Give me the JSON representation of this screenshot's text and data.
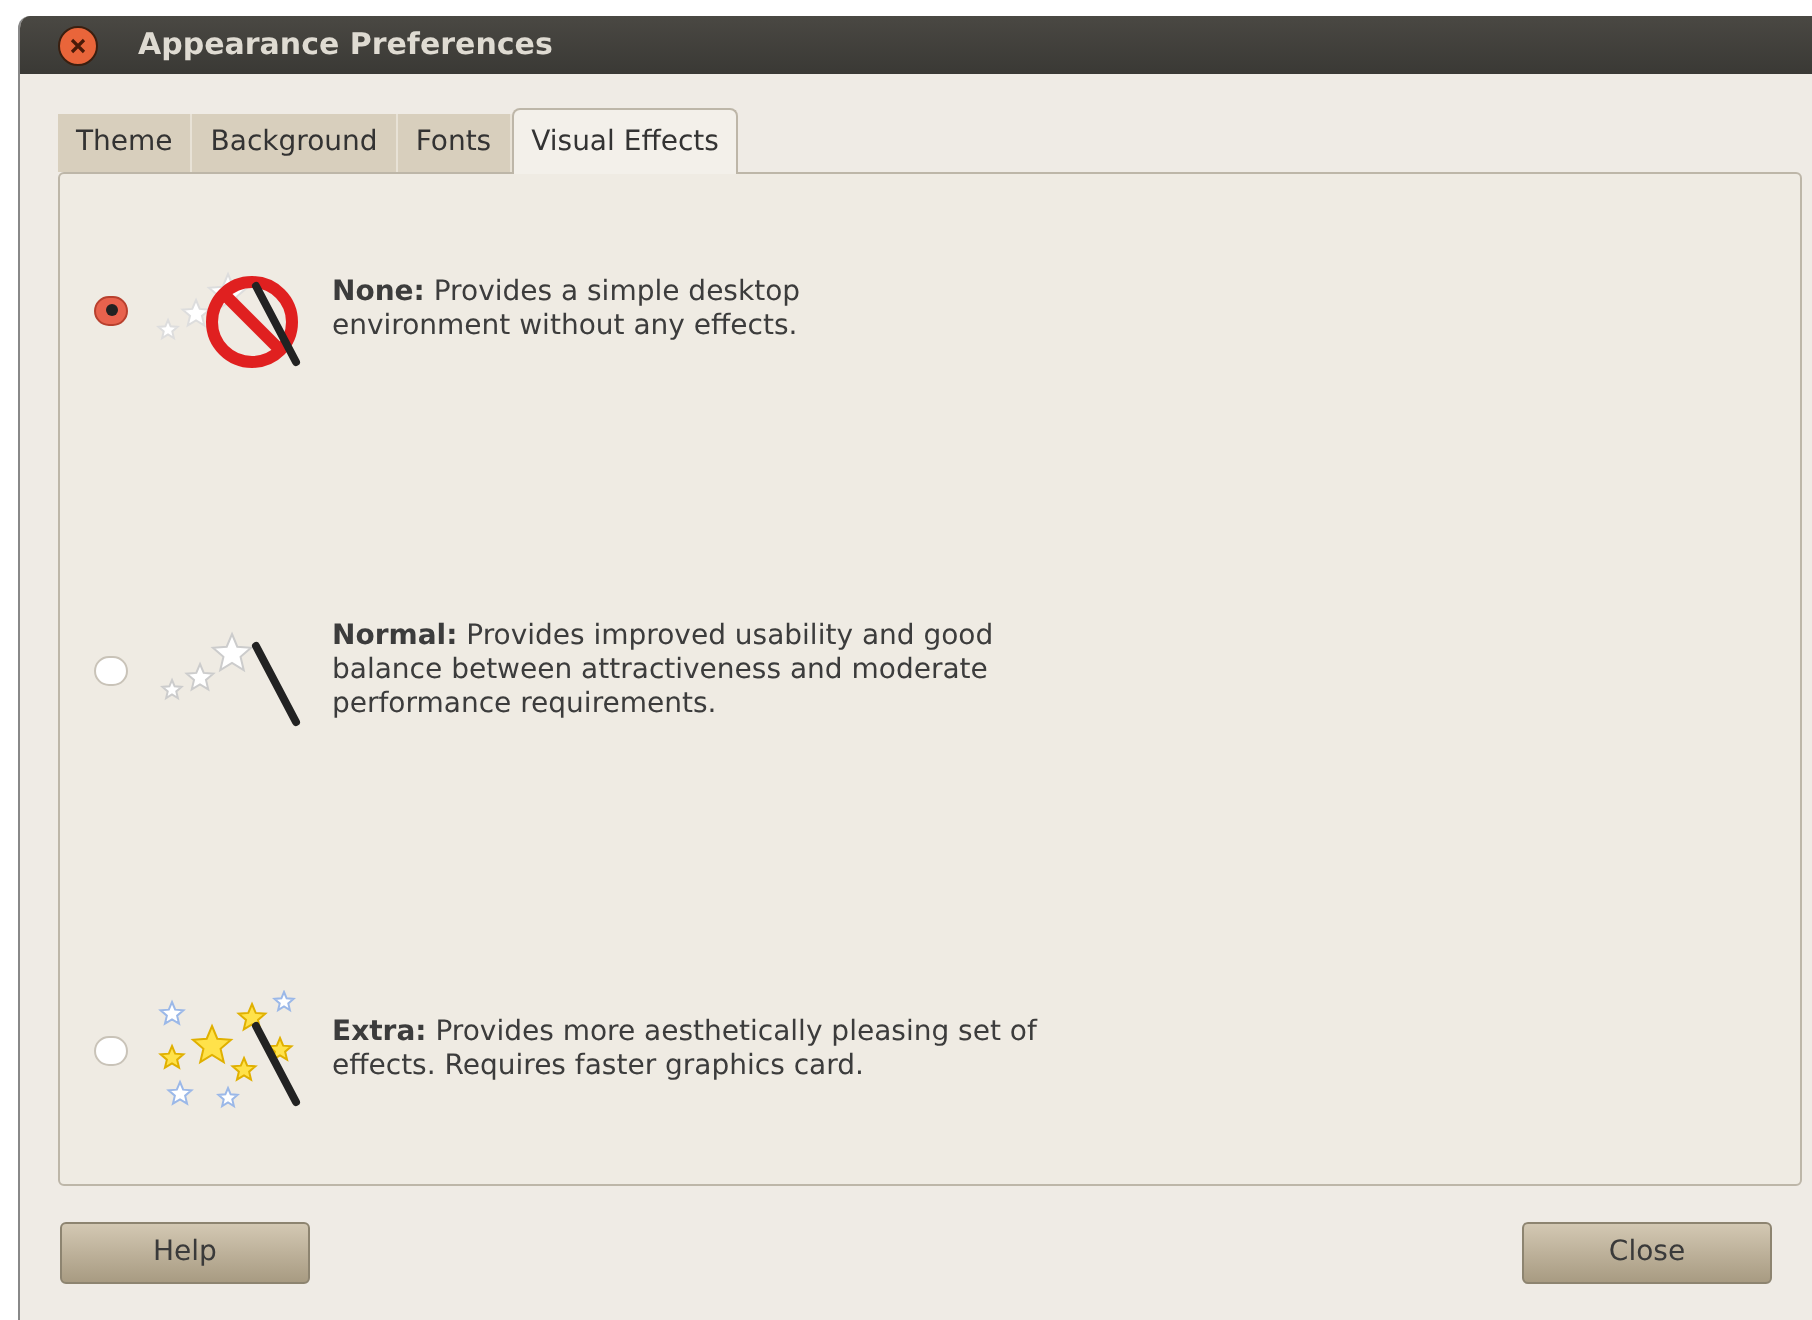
{
  "window": {
    "title": "Appearance Preferences"
  },
  "tabs": [
    {
      "label": "Theme",
      "selected": false
    },
    {
      "label": "Background",
      "selected": false
    },
    {
      "label": "Fonts",
      "selected": false
    },
    {
      "label": "Visual Effects",
      "selected": true
    }
  ],
  "options": [
    {
      "kind": "none",
      "text": "**None:** Provides a simple desktop environment without any effects.",
      "selected": true
    },
    {
      "kind": "normal",
      "text": "**Normal:** Provides improved usability and good balance between attractiveness and moderate performance requirements.",
      "selected": false
    },
    {
      "kind": "extra",
      "text": "**Extra:** Provides more aesthetically pleasing set of effects. Requires faster graphics card.",
      "selected": false
    }
  ],
  "buttons": [
    "Help",
    "Close"
  ]
}
